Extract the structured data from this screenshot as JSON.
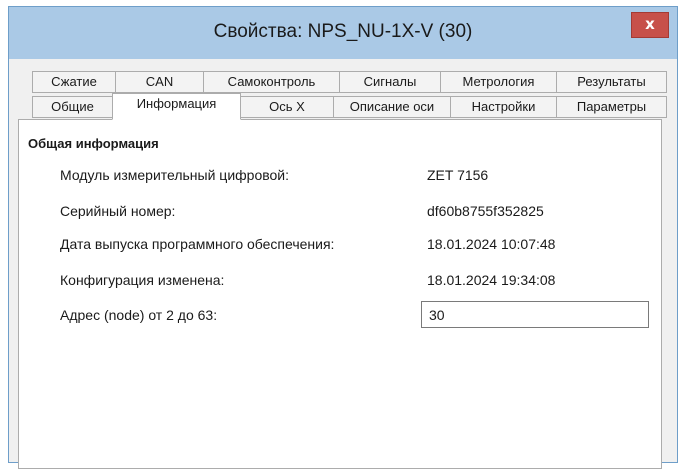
{
  "window": {
    "title": "Свойства: NPS_NU-1X-V (30)",
    "close_glyph": "x"
  },
  "tabs": {
    "row_top": [
      "Сжатие",
      "CAN",
      "Самоконтроль",
      "Сигналы",
      "Метрология",
      "Результаты"
    ],
    "row_bottom": [
      "Общие",
      "Информация",
      "Ось X",
      "Описание оси",
      "Настройки",
      "Параметры"
    ],
    "active": "Информация"
  },
  "info": {
    "section_title": "Общая информация",
    "rows": [
      {
        "label": "Модуль измерительный цифровой:",
        "value": "ZET 7156"
      },
      {
        "label": "Серийный номер:",
        "value": "df60b8755f352825"
      },
      {
        "label": "Дата выпуска программного обеспечения:",
        "value": "18.01.2024 10:07:48"
      },
      {
        "label": "Конфигурация изменена:",
        "value": "18.01.2024 19:34:08"
      }
    ],
    "address_label": "Адрес (node) от 2 до 63:",
    "address_value": "30"
  },
  "colors": {
    "titlebar": "#aac9e6",
    "close_button": "#c7504a",
    "dialog_bg": "#f0f0f0",
    "panel_bg": "#ffffff"
  }
}
